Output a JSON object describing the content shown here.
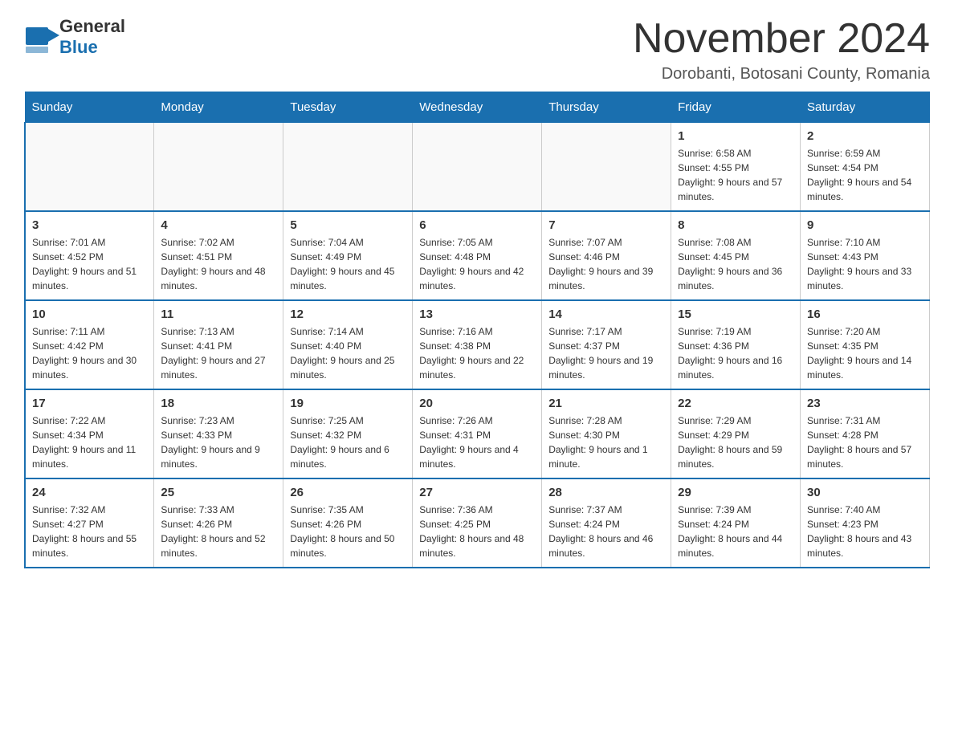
{
  "header": {
    "logo_text_black": "General",
    "logo_text_blue": "Blue",
    "title": "November 2024",
    "subtitle": "Dorobanti, Botosani County, Romania"
  },
  "days_of_week": [
    "Sunday",
    "Monday",
    "Tuesday",
    "Wednesday",
    "Thursday",
    "Friday",
    "Saturday"
  ],
  "weeks": [
    [
      {
        "day": "",
        "info": ""
      },
      {
        "day": "",
        "info": ""
      },
      {
        "day": "",
        "info": ""
      },
      {
        "day": "",
        "info": ""
      },
      {
        "day": "",
        "info": ""
      },
      {
        "day": "1",
        "info": "Sunrise: 6:58 AM\nSunset: 4:55 PM\nDaylight: 9 hours and 57 minutes."
      },
      {
        "day": "2",
        "info": "Sunrise: 6:59 AM\nSunset: 4:54 PM\nDaylight: 9 hours and 54 minutes."
      }
    ],
    [
      {
        "day": "3",
        "info": "Sunrise: 7:01 AM\nSunset: 4:52 PM\nDaylight: 9 hours and 51 minutes."
      },
      {
        "day": "4",
        "info": "Sunrise: 7:02 AM\nSunset: 4:51 PM\nDaylight: 9 hours and 48 minutes."
      },
      {
        "day": "5",
        "info": "Sunrise: 7:04 AM\nSunset: 4:49 PM\nDaylight: 9 hours and 45 minutes."
      },
      {
        "day": "6",
        "info": "Sunrise: 7:05 AM\nSunset: 4:48 PM\nDaylight: 9 hours and 42 minutes."
      },
      {
        "day": "7",
        "info": "Sunrise: 7:07 AM\nSunset: 4:46 PM\nDaylight: 9 hours and 39 minutes."
      },
      {
        "day": "8",
        "info": "Sunrise: 7:08 AM\nSunset: 4:45 PM\nDaylight: 9 hours and 36 minutes."
      },
      {
        "day": "9",
        "info": "Sunrise: 7:10 AM\nSunset: 4:43 PM\nDaylight: 9 hours and 33 minutes."
      }
    ],
    [
      {
        "day": "10",
        "info": "Sunrise: 7:11 AM\nSunset: 4:42 PM\nDaylight: 9 hours and 30 minutes."
      },
      {
        "day": "11",
        "info": "Sunrise: 7:13 AM\nSunset: 4:41 PM\nDaylight: 9 hours and 27 minutes."
      },
      {
        "day": "12",
        "info": "Sunrise: 7:14 AM\nSunset: 4:40 PM\nDaylight: 9 hours and 25 minutes."
      },
      {
        "day": "13",
        "info": "Sunrise: 7:16 AM\nSunset: 4:38 PM\nDaylight: 9 hours and 22 minutes."
      },
      {
        "day": "14",
        "info": "Sunrise: 7:17 AM\nSunset: 4:37 PM\nDaylight: 9 hours and 19 minutes."
      },
      {
        "day": "15",
        "info": "Sunrise: 7:19 AM\nSunset: 4:36 PM\nDaylight: 9 hours and 16 minutes."
      },
      {
        "day": "16",
        "info": "Sunrise: 7:20 AM\nSunset: 4:35 PM\nDaylight: 9 hours and 14 minutes."
      }
    ],
    [
      {
        "day": "17",
        "info": "Sunrise: 7:22 AM\nSunset: 4:34 PM\nDaylight: 9 hours and 11 minutes."
      },
      {
        "day": "18",
        "info": "Sunrise: 7:23 AM\nSunset: 4:33 PM\nDaylight: 9 hours and 9 minutes."
      },
      {
        "day": "19",
        "info": "Sunrise: 7:25 AM\nSunset: 4:32 PM\nDaylight: 9 hours and 6 minutes."
      },
      {
        "day": "20",
        "info": "Sunrise: 7:26 AM\nSunset: 4:31 PM\nDaylight: 9 hours and 4 minutes."
      },
      {
        "day": "21",
        "info": "Sunrise: 7:28 AM\nSunset: 4:30 PM\nDaylight: 9 hours and 1 minute."
      },
      {
        "day": "22",
        "info": "Sunrise: 7:29 AM\nSunset: 4:29 PM\nDaylight: 8 hours and 59 minutes."
      },
      {
        "day": "23",
        "info": "Sunrise: 7:31 AM\nSunset: 4:28 PM\nDaylight: 8 hours and 57 minutes."
      }
    ],
    [
      {
        "day": "24",
        "info": "Sunrise: 7:32 AM\nSunset: 4:27 PM\nDaylight: 8 hours and 55 minutes."
      },
      {
        "day": "25",
        "info": "Sunrise: 7:33 AM\nSunset: 4:26 PM\nDaylight: 8 hours and 52 minutes."
      },
      {
        "day": "26",
        "info": "Sunrise: 7:35 AM\nSunset: 4:26 PM\nDaylight: 8 hours and 50 minutes."
      },
      {
        "day": "27",
        "info": "Sunrise: 7:36 AM\nSunset: 4:25 PM\nDaylight: 8 hours and 48 minutes."
      },
      {
        "day": "28",
        "info": "Sunrise: 7:37 AM\nSunset: 4:24 PM\nDaylight: 8 hours and 46 minutes."
      },
      {
        "day": "29",
        "info": "Sunrise: 7:39 AM\nSunset: 4:24 PM\nDaylight: 8 hours and 44 minutes."
      },
      {
        "day": "30",
        "info": "Sunrise: 7:40 AM\nSunset: 4:23 PM\nDaylight: 8 hours and 43 minutes."
      }
    ]
  ]
}
